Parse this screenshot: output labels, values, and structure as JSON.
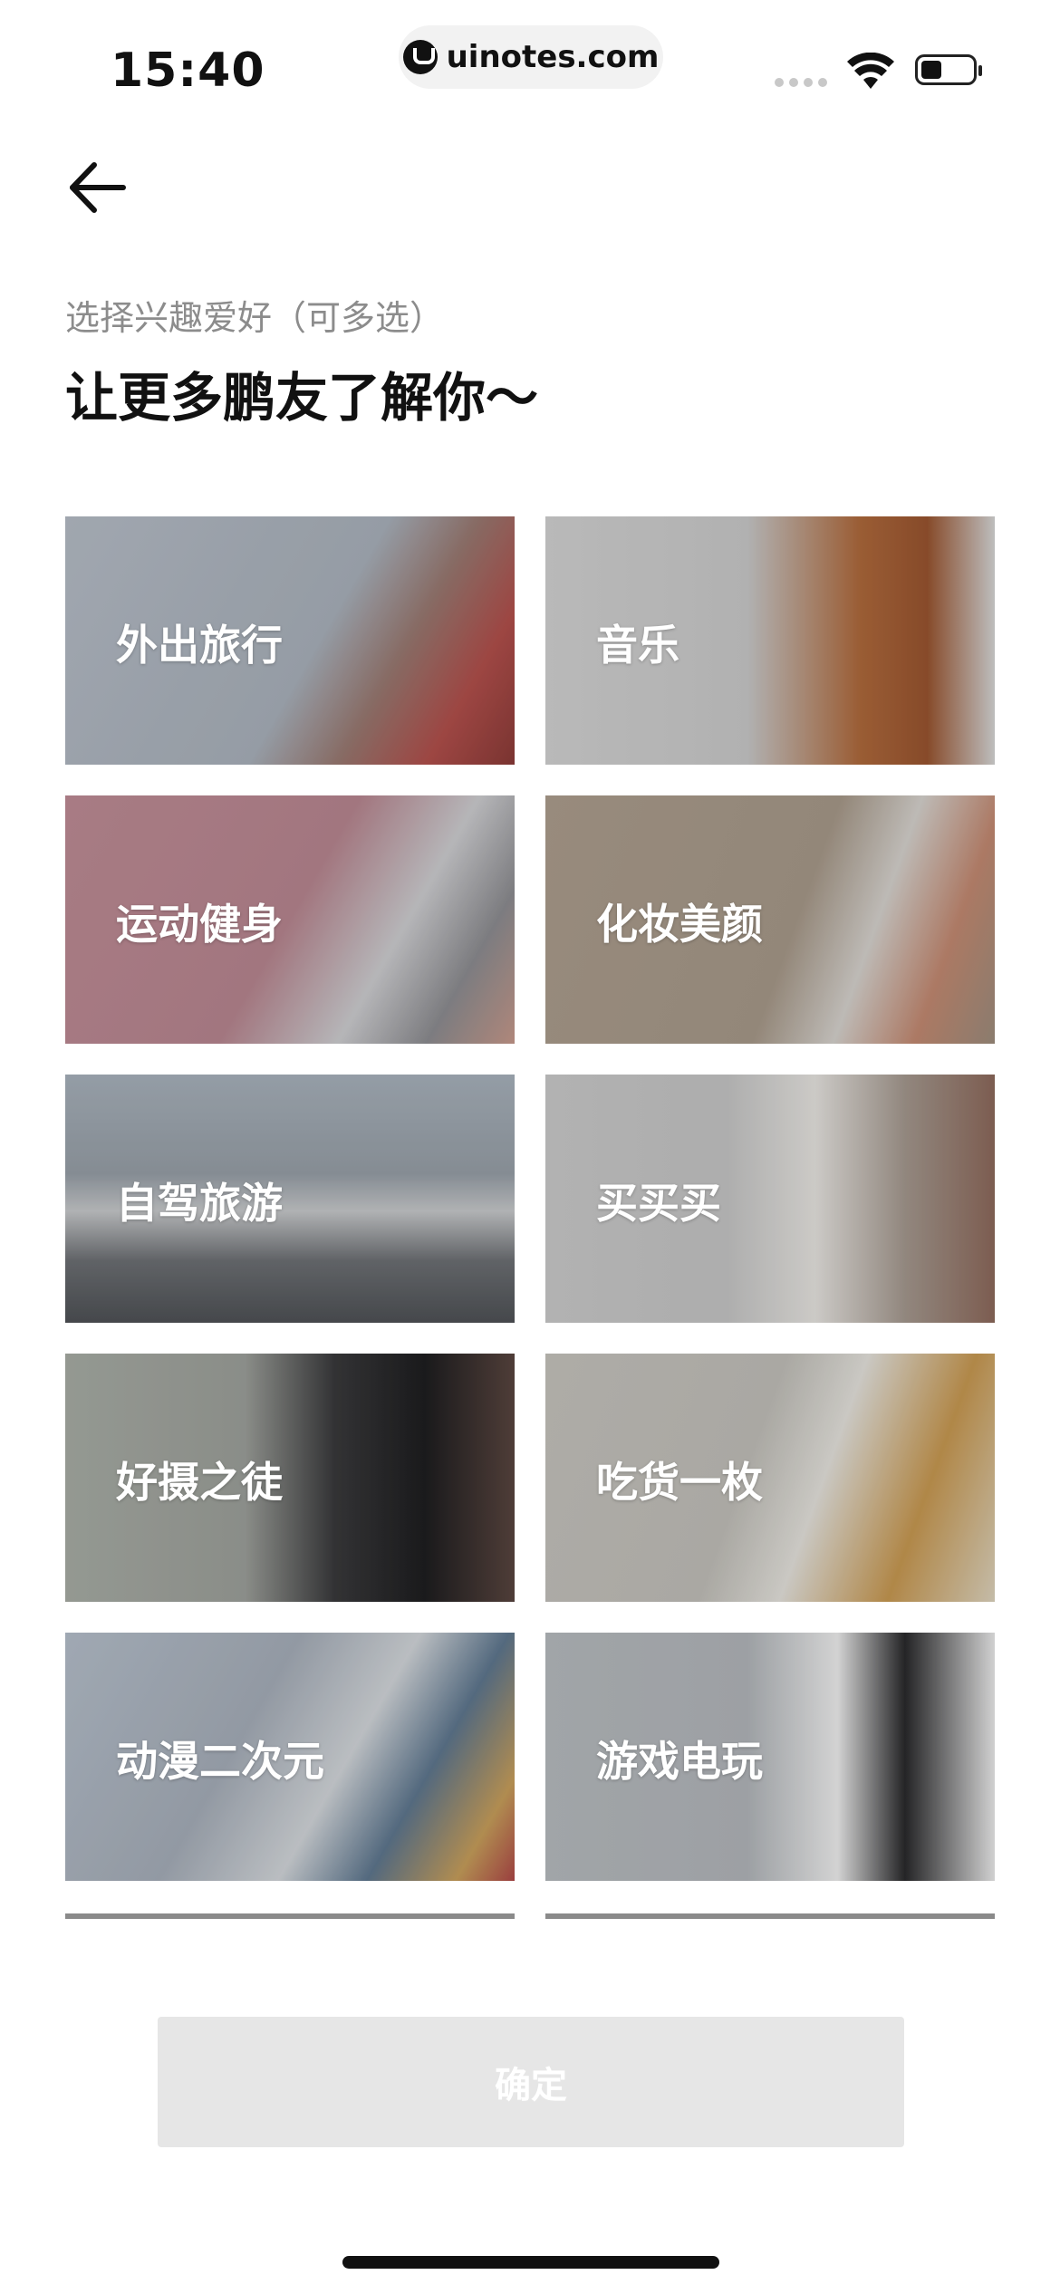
{
  "status_bar": {
    "time": "15:40",
    "url": "uinotes.com"
  },
  "header": {
    "back_icon": "arrow-left-icon",
    "subtitle": "选择兴趣爱好（可多选）",
    "title": "让更多鹏友了解你～"
  },
  "interests": [
    {
      "label": "外出旅行",
      "bg": "#aeb4bd"
    },
    {
      "label": "音乐",
      "bg": "#cfcfcf"
    },
    {
      "label": "运动健身",
      "bg": "#b78a93"
    },
    {
      "label": "化妆美颜",
      "bg": "#a89a8a"
    },
    {
      "label": "自驾旅游",
      "bg": "#8c9096"
    },
    {
      "label": "买买买",
      "bg": "#c6c6c6"
    },
    {
      "label": "好摄之徒",
      "bg": "#9ea19c"
    },
    {
      "label": "吃货一枚",
      "bg": "#c2c0ba"
    },
    {
      "label": "动漫二次元",
      "bg": "#a7afba"
    },
    {
      "label": "游戏电玩",
      "bg": "#b3b7bb"
    }
  ],
  "footer": {
    "confirm_label": "确定"
  },
  "colors": {
    "button_disabled": "#e6e6e6",
    "subtitle_gray": "#8c8c8c"
  }
}
